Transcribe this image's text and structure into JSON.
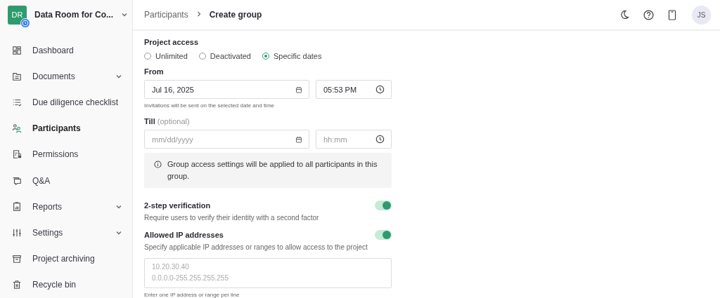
{
  "project": {
    "initials": "DR",
    "name": "Data Room for Co...",
    "color": "#2e9b6e"
  },
  "sidebar": {
    "items": [
      {
        "kind": "dashboard",
        "label": "Dashboard",
        "selected": false,
        "submenu": false
      },
      {
        "kind": "documents",
        "label": "Documents",
        "selected": false,
        "submenu": true
      },
      {
        "kind": "checklist",
        "label": "Due diligence checklist",
        "selected": false,
        "submenu": false
      },
      {
        "kind": "participants",
        "label": "Participants",
        "selected": true,
        "submenu": false
      },
      {
        "kind": "permissions",
        "label": "Permissions",
        "selected": false,
        "submenu": false
      },
      {
        "kind": "qa",
        "label": "Q&A",
        "selected": false,
        "submenu": false
      },
      {
        "kind": "reports",
        "label": "Reports",
        "selected": false,
        "submenu": true
      },
      {
        "kind": "settings",
        "label": "Settings",
        "selected": false,
        "submenu": true
      },
      {
        "kind": "archive",
        "label": "Project archiving",
        "selected": false,
        "submenu": false
      },
      {
        "kind": "trash",
        "label": "Recycle bin",
        "selected": false,
        "submenu": false
      }
    ]
  },
  "breadcrumb": [
    "Participants",
    "Create group"
  ],
  "user": {
    "initials": "JS"
  },
  "project_access": {
    "label": "Project access",
    "options": [
      {
        "label": "Unlimited",
        "selected": false
      },
      {
        "label": "Deactivated",
        "selected": false
      },
      {
        "label": "Specific dates",
        "selected": true
      }
    ]
  },
  "from": {
    "label": "From",
    "date": {
      "value": "Jul 16, 2025"
    },
    "time": {
      "value": "05:53 PM"
    },
    "hint": "Invitations will be sent on the selected date and time"
  },
  "till": {
    "label": "Till",
    "note": "(optional)",
    "date": {
      "placeholder": "mm/dd/yyyy"
    },
    "time": {
      "placeholder": "hh:mm"
    }
  },
  "info": "Group access settings will be applied to all participants in this group.",
  "toggles": [
    {
      "label": "2-step verification",
      "description": "Require users to verify their identity with a second factor",
      "on": true
    },
    {
      "label": "Allowed IP addresses",
      "description": "Specify applicable IP addresses or ranges to allow access to the project",
      "on": true
    }
  ],
  "ip_field": {
    "placeholder": "10.20.30.40\n0.0.0.0-255.255.255.255",
    "hint": "Enter one IP address or range per line"
  }
}
